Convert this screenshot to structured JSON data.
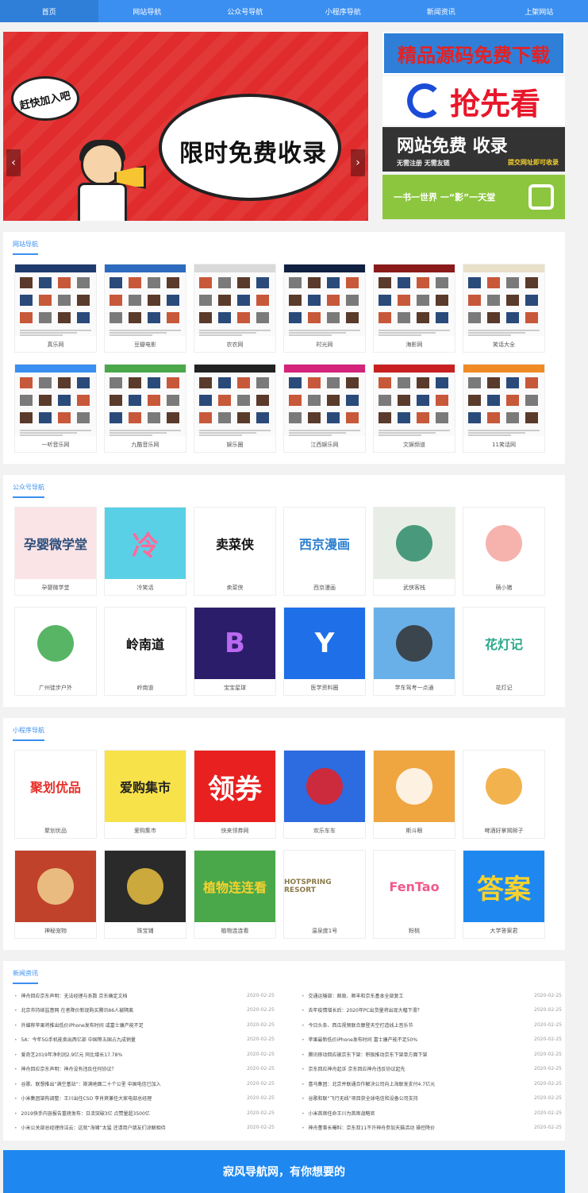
{
  "nav": {
    "items": [
      "首页",
      "网站导航",
      "公众号导航",
      "小程序导航",
      "新闻资讯",
      "上架网站"
    ]
  },
  "banner": {
    "main_text": "限时免费收录",
    "tag_text": "赶快加入吧",
    "prev": "‹",
    "next": "›"
  },
  "ads": [
    {
      "text": "精品源码免费下载"
    },
    {
      "text": "抢先看"
    },
    {
      "text": "网站免费 收录",
      "sub": "无需注册 无需友链",
      "note": "提交网址即可收录"
    },
    {
      "text": "一书一世界  一“影”一天堂"
    }
  ],
  "sites": {
    "title": "网站导航",
    "items": [
      {
        "label": "真乐网",
        "color": "#1f3b6e"
      },
      {
        "label": "豆瓣电影",
        "color": "#2d6bbf"
      },
      {
        "label": "农农网",
        "color": "#d9d9d9"
      },
      {
        "label": "时光网",
        "color": "#102040"
      },
      {
        "label": "海影网",
        "color": "#8b1a1a"
      },
      {
        "label": "笑话大全",
        "color": "#e8e0c8"
      },
      {
        "label": "一听音乐网",
        "color": "#3b8ff0"
      },
      {
        "label": "九酷音乐网",
        "color": "#4aa84a"
      },
      {
        "label": "娱乐圈",
        "color": "#222222"
      },
      {
        "label": "江西娱乐网",
        "color": "#d4237a"
      },
      {
        "label": "文娱频道",
        "color": "#c82020"
      },
      {
        "label": "11笑话网",
        "color": "#f08a24"
      }
    ]
  },
  "official": {
    "title": "公众号导航",
    "items": [
      {
        "label": "孕婴微学堂",
        "glyph": "孕婴微学堂",
        "bg": "#fbe4e6",
        "fg": "#2a4d7a"
      },
      {
        "label": "冷笑话",
        "glyph": "冷",
        "bg": "#5ad0e6",
        "fg": "#ff6a9a"
      },
      {
        "label": "卖菜侠",
        "glyph": "卖菜侠",
        "bg": "#ffffff",
        "fg": "#111111"
      },
      {
        "label": "西京漫画",
        "glyph": "西京漫画",
        "bg": "#ffffff",
        "fg": "#2a7fd0"
      },
      {
        "label": "武侠客栈",
        "glyph": "",
        "bg": "#e8eee6",
        "fg": "#2d8b6a"
      },
      {
        "label": "萌小猪",
        "glyph": "",
        "bg": "#ffffff",
        "fg": "#f4a6a0"
      },
      {
        "label": "广州徒步户外",
        "glyph": "",
        "bg": "#ffffff",
        "fg": "#3ba84a"
      },
      {
        "label": "岭南道",
        "glyph": "岭南道",
        "bg": "#ffffff",
        "fg": "#111111"
      },
      {
        "label": "宝宝星球",
        "glyph": "B",
        "bg": "#2c1d6a",
        "fg": "#b96af0"
      },
      {
        "label": "医学资料圈",
        "glyph": "Y",
        "bg": "#1e6fe8",
        "fg": "#ffffff"
      },
      {
        "label": "学车驾考一点通",
        "glyph": "",
        "bg": "#6ab0e8",
        "fg": "#333333"
      },
      {
        "label": "花灯记",
        "glyph": "花灯记",
        "bg": "#ffffff",
        "fg": "#2aa88a"
      }
    ]
  },
  "mini": {
    "title": "小程序导航",
    "items": [
      {
        "label": "聚划优品",
        "glyph": "聚划优品",
        "bg": "#ffffff",
        "fg": "#e8302a"
      },
      {
        "label": "爱购集市",
        "glyph": "爱购集市",
        "bg": "#f7e24a",
        "fg": "#222222"
      },
      {
        "label": "快来领券网",
        "glyph": "领券",
        "bg": "#e82020",
        "fg": "#ffffff"
      },
      {
        "label": "欢乐车车",
        "glyph": "",
        "bg": "#2d6be0",
        "fg": "#e82020"
      },
      {
        "label": "斯斗眼",
        "glyph": "",
        "bg": "#f0a640",
        "fg": "#ffffff"
      },
      {
        "label": "啤酒好掌揭掰子",
        "glyph": "",
        "bg": "#ffffff",
        "fg": "#f0a630"
      },
      {
        "label": "神秘宠物",
        "glyph": "",
        "bg": "#c0422a",
        "fg": "#f0d090"
      },
      {
        "label": "珠宝铺",
        "glyph": "",
        "bg": "#2a2a2a",
        "fg": "#e8c040"
      },
      {
        "label": "植物连连看",
        "glyph": "植物连连看",
        "bg": "#4aa84a",
        "fg": "#f7d22e"
      },
      {
        "label": "温泉度1号",
        "glyph": "HOTSPRING RESORT",
        "bg": "#ffffff",
        "fg": "#8a7a4a"
      },
      {
        "label": "粉桃",
        "glyph": "FenTao",
        "bg": "#ffffff",
        "fg": "#f05a8a"
      },
      {
        "label": "大学答案君",
        "glyph": "答案",
        "bg": "#1e88f0",
        "fg": "#f7d22e"
      }
    ]
  },
  "news": {
    "title": "新闻资讯",
    "items": [
      {
        "t": "神舟回应京东声明：无法经理与系数 京东确定文档",
        "d": "2020-02-25"
      },
      {
        "t": "交通运输部：邮政、顺丰和京东基本全部复工",
        "d": "2020-02-25"
      },
      {
        "t": "北京市持续监督网 在者降价新现购买腾讯66人被隔离",
        "d": "2020-02-25"
      },
      {
        "t": "去年疫情增长后：2020年PC出货量将出现大幅下滑？",
        "d": "2020-02-25"
      },
      {
        "t": "外媒称苹果将推出低价iPhone发布时间 或富士康产能不足",
        "d": "2020-02-25"
      },
      {
        "t": "今日头条、西瓜视频联合摩登天空打造线上音乐节",
        "d": "2020-02-25"
      },
      {
        "t": "5A：今年5G手机能卖出两亿部 中国等五国占九成销量",
        "d": "2020-02-25"
      },
      {
        "t": "苹果最新低价iPhone发布时间 富士康产能不足50%",
        "d": "2020-02-25"
      },
      {
        "t": "爱奇艺2019年净利润2.9亿元 同比增长17.78%",
        "d": "2020-02-25"
      },
      {
        "t": "腾讯移动回应被京东下架：积极推动京东下架单方面下架",
        "d": "2020-02-25"
      },
      {
        "t": "神舟回应京东声明：神舟没有违反任何协议？",
        "d": "2020-02-25"
      },
      {
        "t": "京东回应神舟起诉 京东回应神舟违反协议起先",
        "d": "2020-02-25"
      },
      {
        "t": "谷歌、联想推出“满空基站”：斯满地面二十个公里 中国电信已加入",
        "d": "2020-02-25"
      },
      {
        "t": "喜马集团：北京并联通合作解决公司向上海联发支付4.7亿元",
        "d": "2020-02-25"
      },
      {
        "t": "小米集团架构调整：王川出任CSO 李肖爽兼任大家电部总经理",
        "d": "2020-02-25"
      },
      {
        "t": "谷歌和联“飞行无线”项目获全球电信和设备公司支持",
        "d": "2020-02-25"
      },
      {
        "t": "2019快手内容报告重磅发布：日活突破3亿 点赞量超3500亿",
        "d": "2020-02-25"
      },
      {
        "t": "小米首席任命王川为首席战略官",
        "d": "2020-02-25"
      },
      {
        "t": "小米公关部总经理徐洁云：这就“海啸”太猛 还请用户朋友们谅解相待",
        "d": "2020-02-25"
      },
      {
        "t": "神舟董事长曝料：京东双11不许神舟参加天猫活动 操控降价",
        "d": "2020-02-25"
      }
    ]
  },
  "footer": {
    "text": "寂风导航网，有你想要的"
  }
}
